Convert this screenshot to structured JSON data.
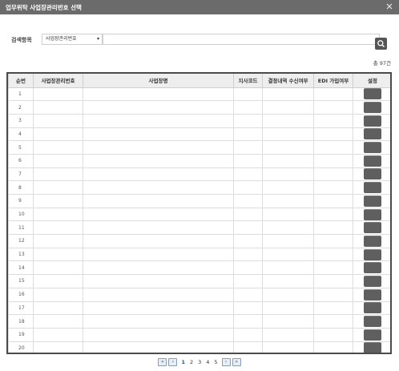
{
  "dialog": {
    "title": "업무위탁 사업장관리번호 선택"
  },
  "search": {
    "label": "검색항목",
    "selected_field": "사업장관리번호",
    "dropdown_arrow": "▾",
    "query_value": ""
  },
  "summary": {
    "total_label": "총 97건"
  },
  "table": {
    "headers": {
      "seq": "순번",
      "mgmt_no": "사업장관리번호",
      "biz_name": "사업장명",
      "branch_code": "지사코드",
      "result_receive": "결정내역 수신여부",
      "edi_join": "EDI 가입여부",
      "setting": "설정"
    },
    "rows": [
      {
        "seq": "1"
      },
      {
        "seq": "2"
      },
      {
        "seq": "3"
      },
      {
        "seq": "4"
      },
      {
        "seq": "5"
      },
      {
        "seq": "6"
      },
      {
        "seq": "7"
      },
      {
        "seq": "8"
      },
      {
        "seq": "9"
      },
      {
        "seq": "10"
      },
      {
        "seq": "11"
      },
      {
        "seq": "12"
      },
      {
        "seq": "13"
      },
      {
        "seq": "14"
      },
      {
        "seq": "15"
      },
      {
        "seq": "16"
      },
      {
        "seq": "17"
      },
      {
        "seq": "18"
      },
      {
        "seq": "19"
      },
      {
        "seq": "20"
      }
    ]
  },
  "pagination": {
    "first": "«",
    "prev": "‹",
    "next": "›",
    "last": "»",
    "pages": [
      "1",
      "2",
      "3",
      "4",
      "5"
    ],
    "current": "1"
  },
  "icons": {
    "close": "close-icon",
    "search": "search-icon"
  }
}
